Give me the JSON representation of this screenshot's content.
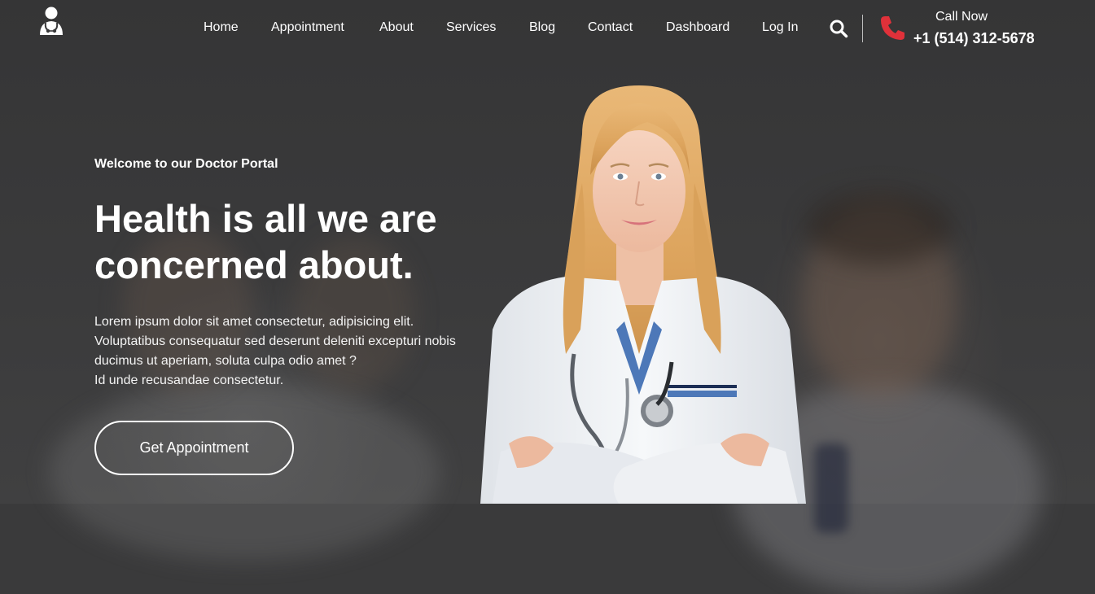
{
  "header": {
    "logo_icon": "doctor-stethoscope-icon",
    "nav": [
      {
        "label": "Home"
      },
      {
        "label": "Appointment"
      },
      {
        "label": "About"
      },
      {
        "label": "Services"
      },
      {
        "label": "Blog"
      },
      {
        "label": "Contact"
      },
      {
        "label": "Dashboard"
      },
      {
        "label": "Log In"
      }
    ],
    "search_icon": "search-icon",
    "call": {
      "icon": "phone-icon",
      "label": "Call Now",
      "number": "+1 (514) 312-5678"
    }
  },
  "hero": {
    "welcome": "Welcome to our Doctor Portal",
    "headline_line1": "Health is all we are",
    "headline_line2": "concerned about.",
    "description": [
      "Lorem ipsum dolor sit amet consectetur, adipisicing elit.",
      "Voluptatibus consequatur sed deserunt deleniti excepturi nobis",
      "ducimus ut aperiam, soluta culpa odio amet ?",
      "Id unde recusandae consectetur."
    ],
    "cta_label": "Get Appointment"
  },
  "colors": {
    "background": "#3a3a3b",
    "text": "#ffffff",
    "phone_accent": "#e0313a"
  }
}
